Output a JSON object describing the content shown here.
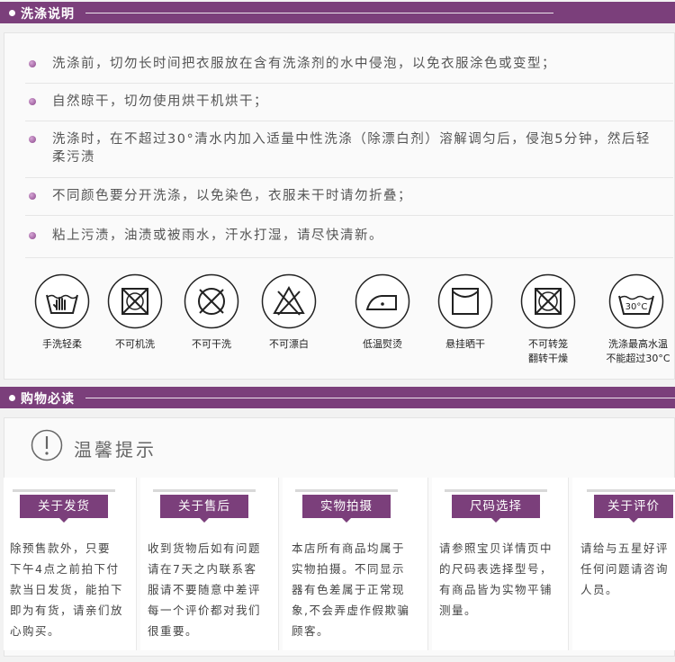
{
  "wash": {
    "title": "洗涤说明",
    "tips": [
      "洗涤前，切勿长时间把衣服放在含有洗涤剂的水中侵泡，以免衣服涂色或变型；",
      "自然晾干，切勿使用烘干机烘干；",
      "洗涤时，在不超过30°清水内加入适量中性洗涤（除漂白剂）溶解调匀后，侵泡5分钟，然后轻柔污渍",
      "不同颜色要分开洗涤，以免染色，衣服未干时请勿折叠；",
      "粘上污渍，油渍或被雨水，汗水打湿，请尽快清新。"
    ],
    "icons": [
      {
        "name": "hand-wash-icon",
        "label": "手洗轻柔"
      },
      {
        "name": "no-machine-wash-icon",
        "label": "不可机洗"
      },
      {
        "name": "no-dry-clean-icon",
        "label": "不可干洗"
      },
      {
        "name": "no-bleach-icon",
        "label": "不可漂白"
      },
      {
        "name": "low-iron-icon",
        "label": "低温熨烫"
      },
      {
        "name": "hang-dry-icon",
        "label": "悬挂晒干"
      },
      {
        "name": "no-tumble-dry-icon",
        "label": "不可转笼",
        "label2": "翻转干燥"
      },
      {
        "name": "max-30-wash-icon",
        "label": "洗涤最高水温",
        "label2": "不能超过30°C",
        "temp": "30°C"
      }
    ]
  },
  "shopping": {
    "title": "购物必读",
    "warm_title": "温馨提示",
    "cols": [
      {
        "tag": "关于发货",
        "lines": [
          "除预售款外，只要",
          "下午4点之前拍下付",
          "款当日发货，能拍下",
          "即为有货，请亲们放",
          "心购买。"
        ]
      },
      {
        "tag": "关于售后",
        "lines": [
          "收到货物后如有问题",
          "请在7天之内联系客",
          "服请不要随意中差评",
          "每一个评价都对我们",
          "很重要。"
        ]
      },
      {
        "tag": "实物拍摄",
        "lines": [
          "本店所有商品均属于",
          "实物拍摄。不同显示",
          "器有色差属于正常现",
          "象,不会弄虚作假欺骗",
          "顾客。"
        ]
      },
      {
        "tag": "尺码选择",
        "lines": [
          "请参照宝贝详情页中",
          "的尺码表选择型号，",
          "有商品皆为实物平铺",
          "测量。"
        ]
      },
      {
        "tag": "关于评价",
        "lines": [
          "请给与五星好评",
          "任何问题请咨询",
          "人员。"
        ]
      }
    ]
  }
}
